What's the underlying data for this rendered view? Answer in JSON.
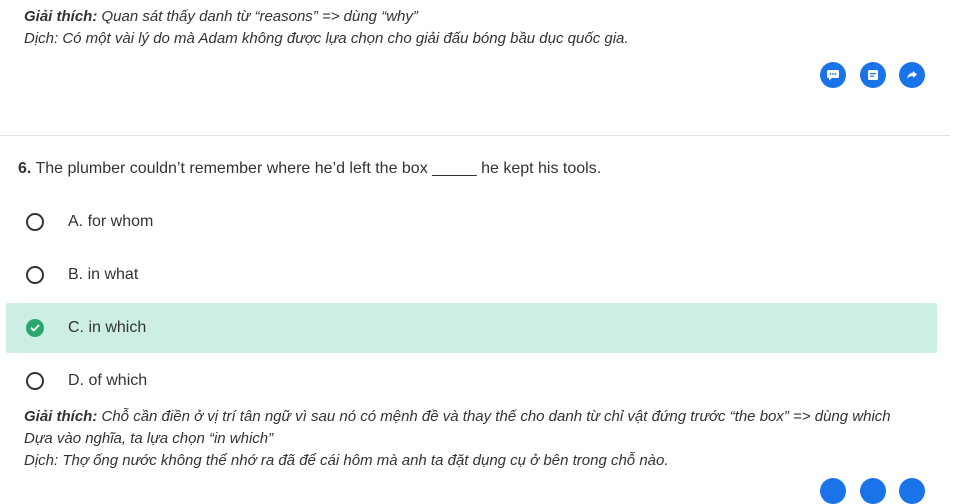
{
  "prev": {
    "explain_label": "Giải thích:",
    "explain_text": " Quan sát thấy danh từ “reasons” => dùng “why”",
    "translate_text": "Dịch: Có một vài lý do mà Adam không được lựa chọn cho giải đấu bóng bầu dục quốc gia."
  },
  "actions": [
    "comment-icon",
    "note-icon",
    "share-icon"
  ],
  "question": {
    "number": "6.",
    "text": " The plumber couldn’t remember where he’d left the box _____ he kept his tools."
  },
  "options": [
    {
      "label": "A. for whom",
      "selected": false
    },
    {
      "label": "B. in what",
      "selected": false
    },
    {
      "label": "C. in which",
      "selected": true
    },
    {
      "label": "D. of which",
      "selected": false
    }
  ],
  "explanation": {
    "label": "Giải thích:",
    "text": " Chỗ cần điền ở vị trí tân ngữ vì sau nó có mệnh đề và thay thế cho danh từ chỉ vật đứng trước “the box” => dùng which",
    "line2": "Dựa vào nghĩa, ta lựa chọn “in which”",
    "line3": "Dịch: Thợ ống nước không thể nhớ ra đã để cái hôm mà anh ta đặt dụng cụ ở bên trong chỗ nào."
  },
  "colors": {
    "accent": "#1a73e8",
    "correct_bg": "#cdeee5",
    "correct_icon": "#2aa66f"
  }
}
